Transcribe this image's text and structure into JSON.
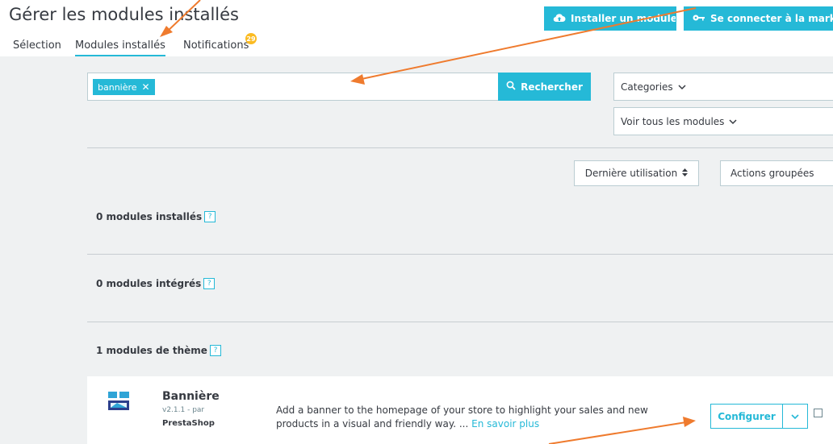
{
  "page": {
    "title": "Gérer les modules installés"
  },
  "toolbar": {
    "install_label": "Installer un module",
    "install_icon": "cloud-upload-icon",
    "connect_label": "Se connecter à la marketplace",
    "connect_icon": "key-icon"
  },
  "tabs": [
    {
      "label": "Sélection",
      "active": false
    },
    {
      "label": "Modules installés",
      "active": true
    },
    {
      "label": "Notifications",
      "active": false,
      "badge": "29"
    }
  ],
  "search": {
    "tag_label": "bannière",
    "button_label": "Rechercher"
  },
  "filters": {
    "categories_label": "Categories",
    "all_modules_label": "Voir tous les modules",
    "sort_label": "Dernière utilisation",
    "bulk_actions_label": "Actions groupées"
  },
  "sections": [
    {
      "title": "0 modules installés",
      "help": "?"
    },
    {
      "title": "0 modules intégrés",
      "help": "?"
    },
    {
      "title": "1 modules de thème",
      "help": "?"
    }
  ],
  "module": {
    "name": "Bannière",
    "version": "v2.1.1 - par",
    "author": "PrestaShop",
    "description": "Add a banner to the homepage of your store to highlight your sales and new products in a visual and friendly way. ...",
    "more_link": "En savoir plus",
    "configure_label": "Configurer"
  },
  "colors": {
    "accent": "#25b9d7",
    "annotation_arrow": "#ef7b2e",
    "background": "#eff1f2",
    "badge": "#fbbb22"
  }
}
